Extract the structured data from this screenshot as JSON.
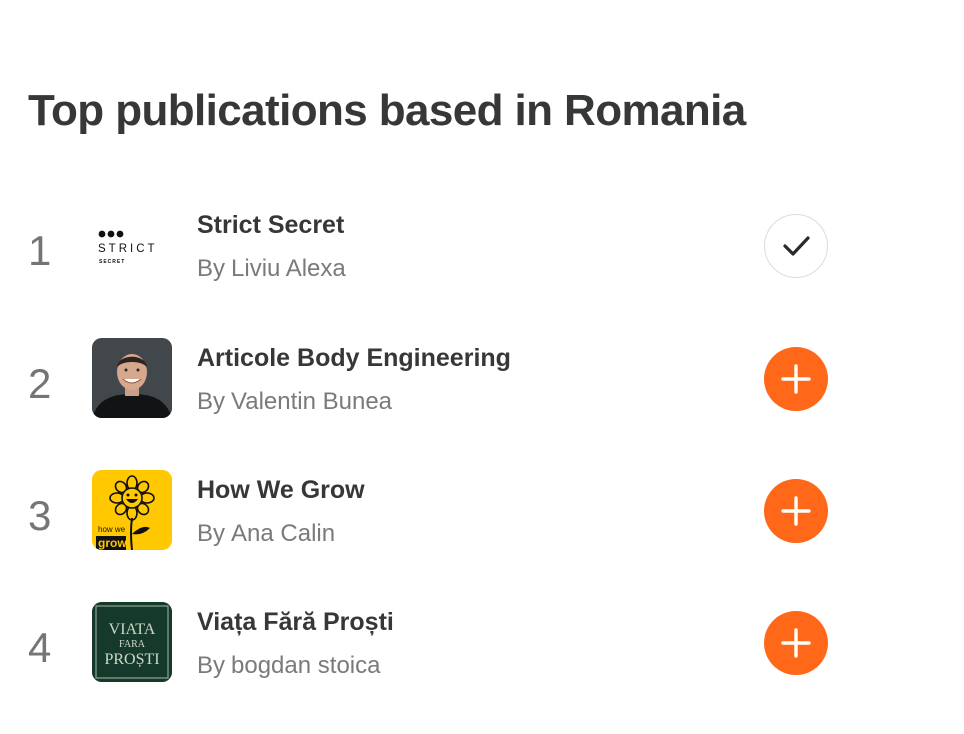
{
  "title": "Top publications based in Romania",
  "accent_color": "#ff6719",
  "by_prefix": "By",
  "publications": [
    {
      "rank": "1",
      "name": "Strict Secret",
      "author": "Liviu Alexa",
      "subscribed": true,
      "logo": {
        "line1": "STRICT",
        "line2": "SECRET"
      }
    },
    {
      "rank": "2",
      "name": "Articole Body Engineering",
      "author": "Valentin Bunea",
      "subscribed": false
    },
    {
      "rank": "3",
      "name": "How We Grow",
      "author": "Ana Calin",
      "subscribed": false,
      "logo": {
        "line1": "how we",
        "line2": "grow"
      }
    },
    {
      "rank": "4",
      "name": "Viața Fără Proști",
      "author": "bogdan stoica",
      "subscribed": false,
      "logo": {
        "line1": "VIATA",
        "line2": "FARA",
        "line3": "PROȘTI"
      }
    }
  ]
}
